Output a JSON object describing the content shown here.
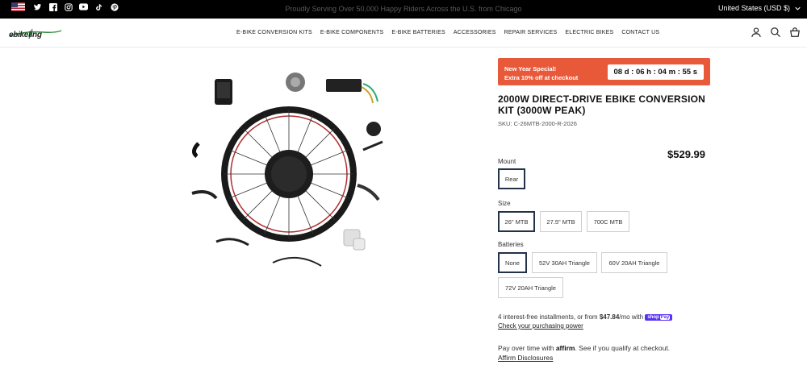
{
  "topbar": {
    "announcement": "Proudly Serving Over 50,000 Happy Riders Across the U.S. from Chicago",
    "currency": "United States (USD $)",
    "social": [
      "us-flag-icon",
      "twitter-icon",
      "facebook-icon",
      "instagram-icon",
      "youtube-icon",
      "tiktok-icon",
      "pinterest-icon"
    ]
  },
  "header": {
    "logo_text": "ebikeling",
    "nav": [
      "E-BIKE CONVERSION KITS",
      "E-BIKE COMPONENTS",
      "E-BIKE BATTERIES",
      "ACCESSORIES",
      "REPAIR SERVICES",
      "ELECTRIC BIKES",
      "CONTACT US"
    ]
  },
  "product": {
    "promo_line1": "New Year Special!",
    "promo_line2": "Extra 10% off at checkout",
    "countdown": "08 d : 06 h : 04 m : 55 s",
    "title": "2000W DIRECT-DRIVE EBIKE CONVERSION KIT (3000W PEAK)",
    "sku": "SKU: C-26MTB-2000-R-2026",
    "price": "$529.99",
    "mount_label": "Mount",
    "mount_options": [
      "Rear"
    ],
    "size_label": "Size",
    "size_options": [
      "26\" MTB",
      "27.5\" MTB",
      "700C MTB"
    ],
    "batteries_label": "Batteries",
    "battery_options": [
      "None",
      "52V 30AH Triangle",
      "60V 20AH Triangle",
      "72V 20AH Triangle"
    ],
    "installments_text": "4 interest-free installments, or from ",
    "installments_amount": "$47.84",
    "installments_suffix": "/mo with",
    "shop_text": "shop",
    "pay_text": "Pay",
    "check_power": "Check your purchasing power",
    "affirm_prefix": "Pay over time with",
    "affirm_brand": "affirm",
    "affirm_suffix": ". See if you qualify at checkout.",
    "affirm_disclosures": "Affirm Disclosures"
  },
  "colors": {
    "promo_bg": "#e8593a",
    "selected_border": "#24314a",
    "shoppay": "#5a31f4"
  }
}
